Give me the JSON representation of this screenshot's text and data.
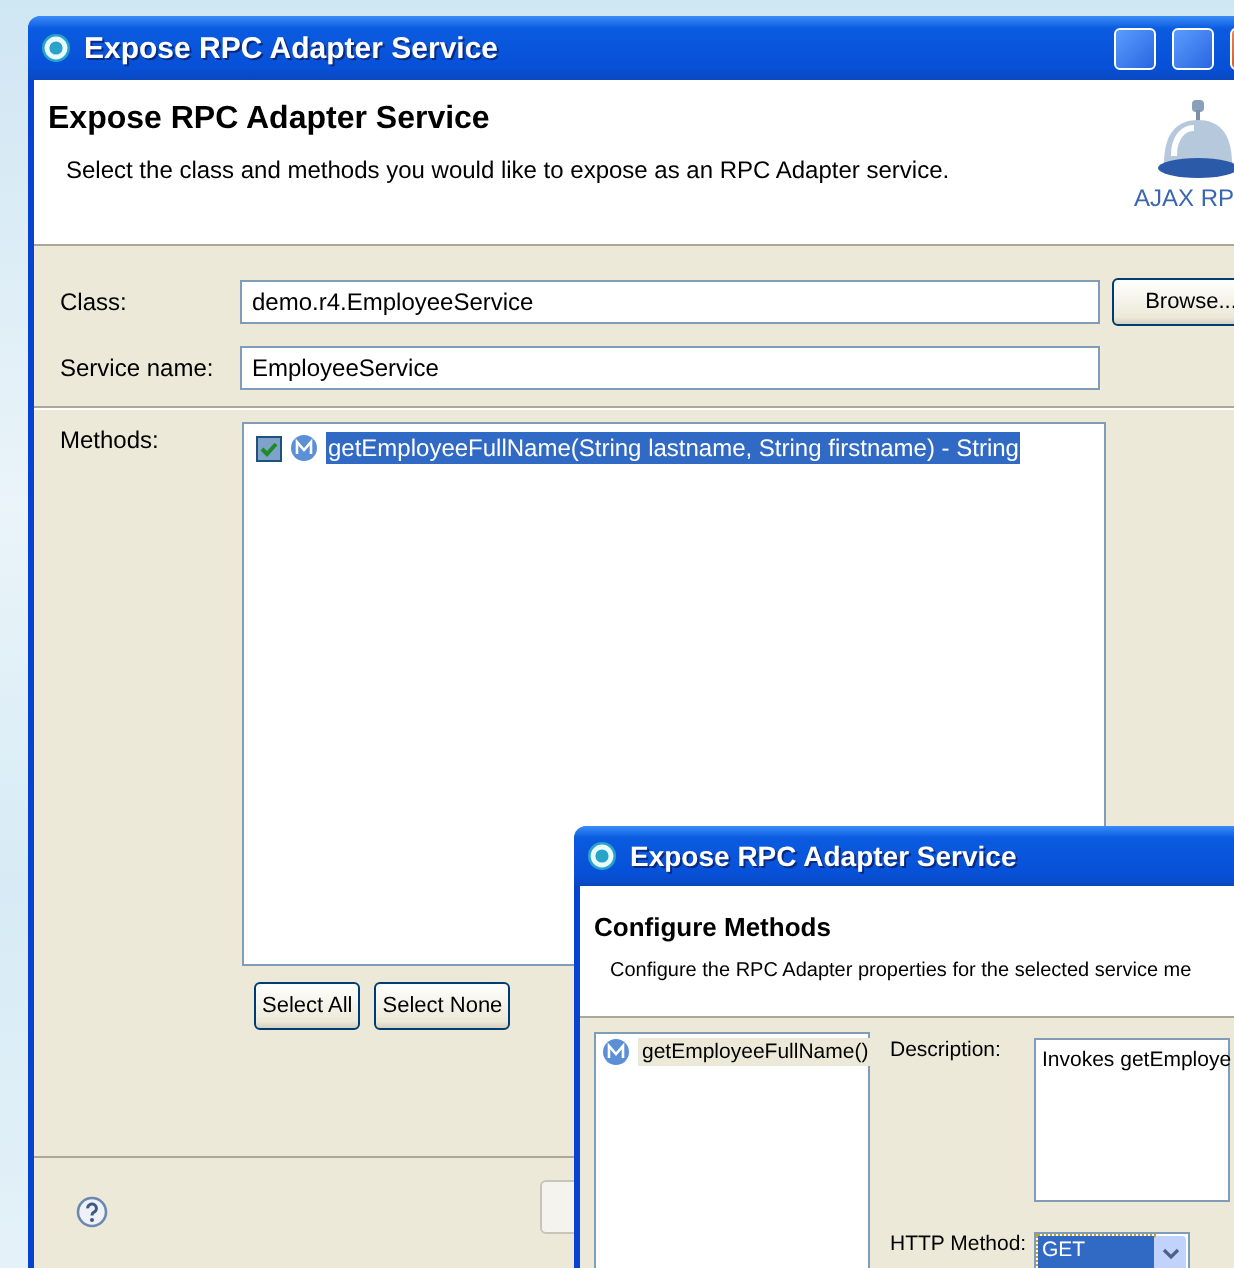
{
  "window": {
    "title": "Expose RPC Adapter Service"
  },
  "header": {
    "title": "Expose RPC Adapter Service",
    "description": "Select the class and methods you would like to expose as an RPC Adapter service.",
    "logo_caption": "AJAX RP"
  },
  "fields": [
    {
      "label": "Class:",
      "value": "demo.r4.EmployeeService",
      "button": "Browse..."
    },
    {
      "label": "Service name:",
      "value": "EmployeeService"
    }
  ],
  "methods": {
    "label": "Methods:",
    "items": [
      {
        "name": "getEmployeeFullName(String lastname, String firstname) - String",
        "checked": true,
        "selected": true
      }
    ]
  },
  "list_buttons": [
    "Select All",
    "Select None"
  ],
  "dialog": {
    "title": "Expose RPC Adapter Service",
    "header_title": "Configure Methods",
    "header_description": "Configure the RPC Adapter properties for the selected service me",
    "methods": [
      {
        "name": "getEmployeeFullName()",
        "selected": true
      }
    ],
    "description_label": "Description:",
    "description_value": "Invokes getEmploye",
    "http_method_label": "HTTP Method:",
    "http_method_value": "GET"
  }
}
